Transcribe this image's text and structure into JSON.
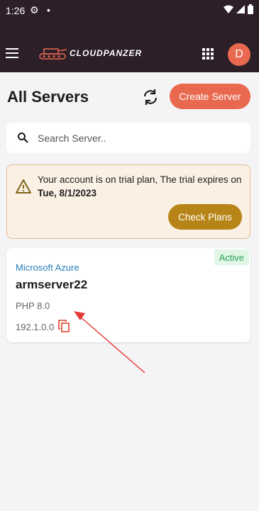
{
  "status_bar": {
    "time": "1:26"
  },
  "app_bar": {
    "logo_text": "CLOUDPANZER",
    "avatar_letter": "D"
  },
  "page": {
    "title": "All Servers",
    "create_button": "Create Server"
  },
  "search": {
    "placeholder": "Search Server..",
    "value": ""
  },
  "trial_notice": {
    "message": "Your account is on trial plan, The trial expires on",
    "expiry_date": "Tue, 8/1/2023",
    "button": "Check Plans"
  },
  "servers": [
    {
      "status": "Active",
      "provider": "Microsoft Azure",
      "name": "armserver22",
      "php": "PHP 8.0",
      "ip": "192.1.0.0"
    }
  ],
  "colors": {
    "accent": "#e8694f",
    "header": "#2c1f28",
    "gold": "#b78517",
    "active_green": "#2da35a",
    "annotation_arrow": "#e53935"
  },
  "icons": [
    "menu-icon",
    "apps-grid-icon",
    "refresh-icon",
    "search-icon",
    "warning-icon",
    "copy-icon",
    "settings-icon",
    "wifi-icon",
    "signal-icon",
    "battery-icon"
  ]
}
